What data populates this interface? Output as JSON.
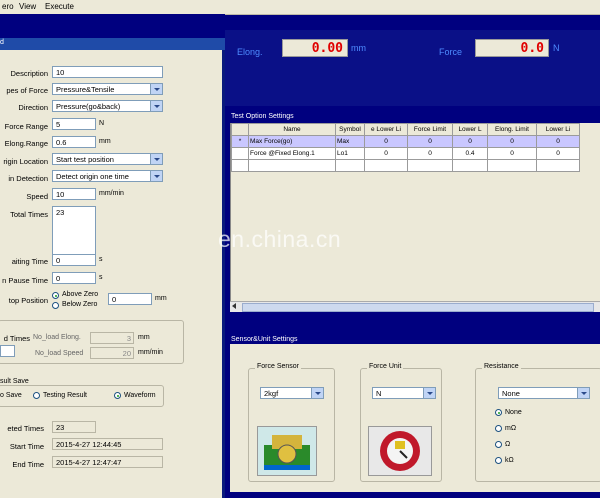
{
  "menu": [
    "ero",
    "View",
    "Execute"
  ],
  "left_title": "d",
  "form": {
    "description_label": "Description",
    "description_value": "10",
    "types_label": "pes of Force",
    "types_value": "Pressure&Tensile",
    "direction_label": "Direction",
    "direction_value": "Pressure(go&back)",
    "force_range_label": "Force Range",
    "force_range_value": "5",
    "force_range_unit": "N",
    "elong_range_label": "Elong.Range",
    "elong_range_value": "0.6",
    "elong_range_unit": "mm",
    "origin_location_label": "rigin Location",
    "origin_location_value": "Start test position",
    "origin_detection_label": "in Detection",
    "origin_detection_value": "Detect origin one time",
    "speed_label": "Speed",
    "speed_value": "10",
    "speed_unit": "mm/min",
    "total_times_label": "Total Times",
    "total_times_value": "23",
    "waiting_time_label": "aiting Time",
    "waiting_time_value": "0",
    "waiting_time_unit": "s",
    "pause_time_label": "n Pause Time",
    "pause_time_value": "0",
    "pause_time_unit": "s",
    "stop_position_label": "top Position",
    "above_zero": "Above Zero",
    "below_zero": "Below Zero",
    "stop_value": "0",
    "stop_unit": "mm",
    "noload_times_label": "d Times",
    "noload_elong_label": "No_load Elong.",
    "noload_elong_value": "3",
    "noload_elong_unit": "mm",
    "noload_speed_label": "No_load Speed",
    "noload_speed_value": "20",
    "noload_speed_unit": "mm/min",
    "result_save_label": "sult Save",
    "no_save": "o Save",
    "testing_result": "Testing Result",
    "waveform": "Waveform",
    "completed_times_label": "eted Times",
    "completed_times_value": "23",
    "start_time_label": "Start Time",
    "start_time_value": "2015-4-27 12:44:45",
    "end_time_label": "End Time",
    "end_time_value": "2015-4-27 12:47:47"
  },
  "readout": {
    "elong_label": "Elong.",
    "elong_value": "0.00",
    "elong_unit": "mm",
    "force_label": "Force",
    "force_value": "0.0",
    "force_unit": "N"
  },
  "test_options": {
    "title": "Test Option Settings",
    "headers": [
      "",
      "Name",
      "Symbol",
      "e Lower Li",
      "Force Limit",
      "Lower L",
      "Elong. Limit",
      "Lower Li"
    ],
    "rows": [
      [
        "*",
        "Max Force(go)",
        "Max",
        "0",
        "0",
        "0",
        "0",
        "0"
      ],
      [
        "",
        "Force @Fixed Elong.1",
        "Lo1",
        "0",
        "0",
        "0.4",
        "0",
        "0"
      ]
    ]
  },
  "sensor": {
    "title": "Sensor&Unit Settings",
    "force_sensor_label": "Force Sensor",
    "force_sensor_value": "2kgf",
    "force_unit_label": "Force Unit",
    "force_unit_value": "N",
    "resistance_label": "Resistance",
    "resistance_value": "None",
    "resistance_options": [
      "None",
      "mΩ",
      "Ω",
      "kΩ"
    ]
  },
  "watermark": "en.china.cn"
}
